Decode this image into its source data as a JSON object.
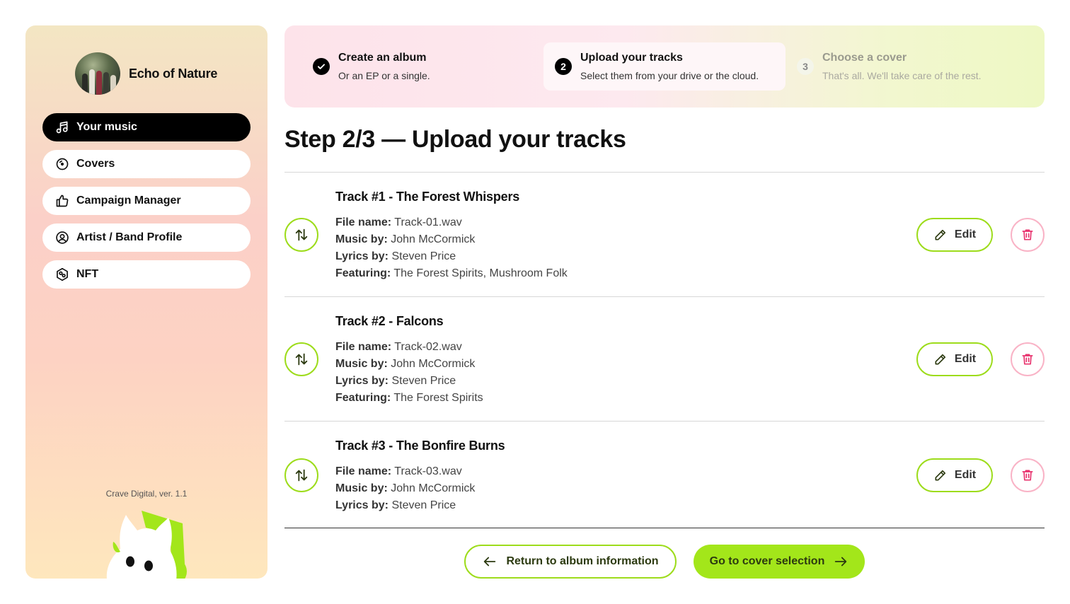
{
  "colors": {
    "accent": "#a3e61a",
    "accent_border": "#9ddc1b",
    "danger": "#e8336e",
    "danger_border": "#f9b3c6"
  },
  "profile": {
    "name": "Echo of Nature"
  },
  "nav": [
    {
      "label": "Your music",
      "icon": "music-note-icon",
      "active": true
    },
    {
      "label": "Covers",
      "icon": "disc-icon",
      "active": false
    },
    {
      "label": "Campaign Manager",
      "icon": "thumbs-up-icon",
      "active": false
    },
    {
      "label": "Artist / Band Profile",
      "icon": "user-circle-icon",
      "active": false
    },
    {
      "label": "NFT",
      "icon": "nft-hexagon-icon",
      "active": false
    }
  ],
  "version": "Crave Digital, ver. 1.1",
  "steps": [
    {
      "num": "",
      "title": "Create an album",
      "desc": "Or an EP or a single.",
      "state": "done"
    },
    {
      "num": "2",
      "title": "Upload your tracks",
      "desc": "Select them from your drive or the cloud.",
      "state": "current"
    },
    {
      "num": "3",
      "title": "Choose a cover",
      "desc": "That's all. We'll take care of the rest.",
      "state": "upcoming"
    }
  ],
  "page_title": "Step 2/3 — Upload your tracks",
  "labels": {
    "file": "File name:",
    "music": "Music by:",
    "lyrics": "Lyrics by:",
    "featuring": "Featuring:",
    "edit": "Edit"
  },
  "tracks": [
    {
      "title": "Track #1 - The Forest Whispers",
      "file": "Track-01.wav",
      "music": "John McCormick",
      "lyrics": "Steven Price",
      "featuring": "The Forest Spirits, Mushroom Folk"
    },
    {
      "title": "Track #2 - Falcons",
      "file": "Track-02.wav",
      "music": "John McCormick",
      "lyrics": "Steven Price",
      "featuring": "The Forest Spirits"
    },
    {
      "title": "Track #3 - The Bonfire Burns",
      "file": "Track-03.wav",
      "music": "John McCormick",
      "lyrics": "Steven Price"
    }
  ],
  "buttons": {
    "back": "Return to album information",
    "next": "Go to cover selection"
  }
}
